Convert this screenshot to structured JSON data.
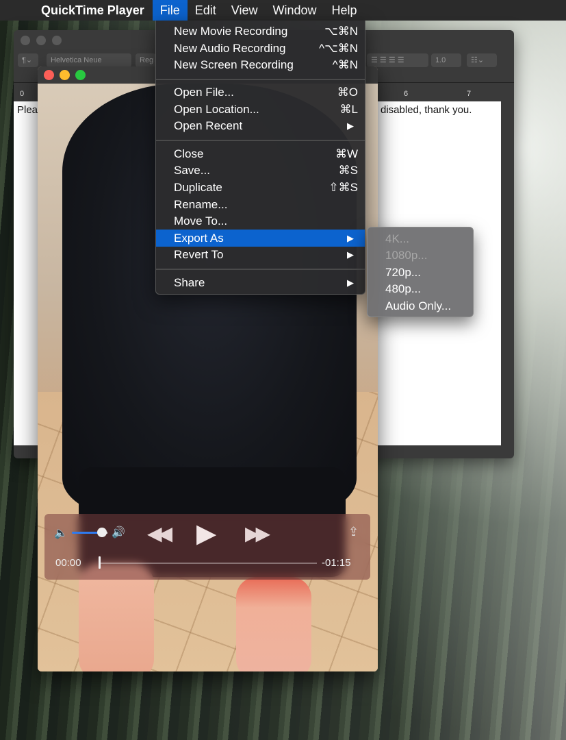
{
  "menubar": {
    "apple_icon": "apple-logo-icon",
    "app_name": "QuickTime Player",
    "items": [
      "File",
      "Edit",
      "View",
      "Window",
      "Help"
    ],
    "active": "File"
  },
  "textedit": {
    "font_name": "Helvetica Neue",
    "font_style": "Reg",
    "line_spacing": "1.0",
    "ruler_numbers": [
      "0",
      "6",
      "7"
    ],
    "text_left": "Plea",
    "text_right": "disabled, thank you."
  },
  "file_menu": {
    "items": [
      {
        "label": "New Movie Recording",
        "shortcut": "⌥⌘N"
      },
      {
        "label": "New Audio Recording",
        "shortcut": "^⌥⌘N"
      },
      {
        "label": "New Screen Recording",
        "shortcut": "^⌘N"
      },
      {
        "label": "Open File...",
        "shortcut": "⌘O"
      },
      {
        "label": "Open Location...",
        "shortcut": "⌘L"
      },
      {
        "label": "Open Recent",
        "arrow": "▶"
      },
      {
        "label": "Close",
        "shortcut": "⌘W"
      },
      {
        "label": "Save...",
        "shortcut": "⌘S"
      },
      {
        "label": "Duplicate",
        "shortcut": "⇧⌘S"
      },
      {
        "label": "Rename..."
      },
      {
        "label": "Move To..."
      },
      {
        "label": "Export As",
        "arrow": "▶"
      },
      {
        "label": "Revert To",
        "arrow": "▶"
      },
      {
        "label": "Share",
        "arrow": "▶"
      }
    ]
  },
  "export_submenu": {
    "items": [
      {
        "label": "4K...",
        "enabled": false
      },
      {
        "label": "1080p...",
        "enabled": false
      },
      {
        "label": "720p...",
        "enabled": true
      },
      {
        "label": "480p...",
        "enabled": true
      },
      {
        "label": "Audio Only...",
        "enabled": true
      }
    ]
  },
  "player": {
    "current_time": "00:00",
    "remaining_time": "-01:15",
    "volume_level": 0.85,
    "progress": 0.0,
    "icons": {
      "volume_low": "🔈",
      "volume_high": "🔊",
      "rewind": "◀◀",
      "play": "▶",
      "fast_forward": "▶▶",
      "share": "⇪"
    }
  },
  "colors": {
    "menu_highlight": "#0c63ce",
    "close": "#fd5f57",
    "minimize": "#febc2e",
    "zoom": "#28c840"
  }
}
